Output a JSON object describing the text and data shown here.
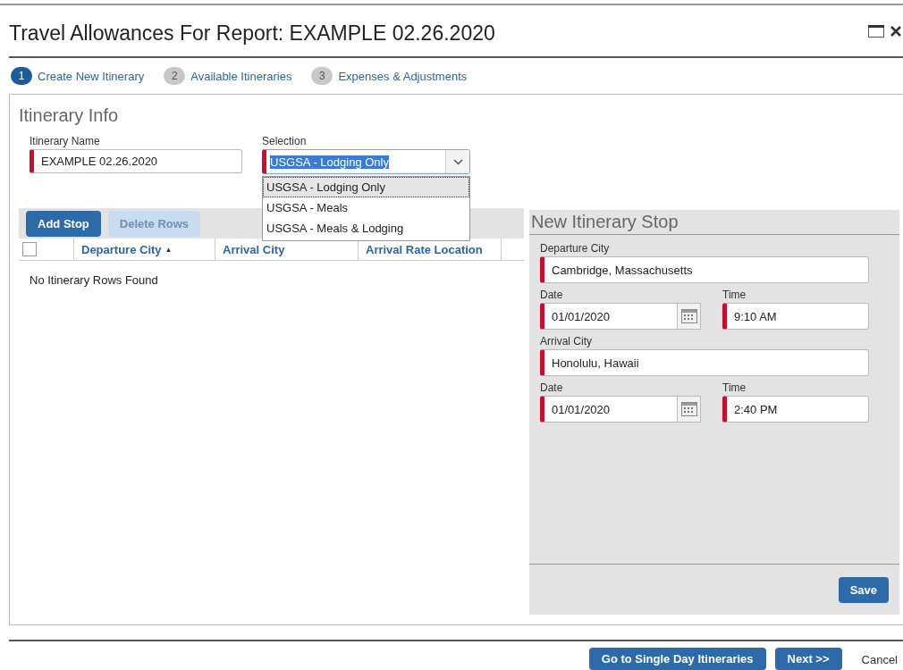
{
  "window": {
    "title": "Travel Allowances For Report: EXAMPLE 02.26.2020"
  },
  "steps": [
    {
      "number": "1",
      "label": "Create New Itinerary",
      "selected": true
    },
    {
      "number": "2",
      "label": "Available Itineraries",
      "selected": false
    },
    {
      "number": "3",
      "label": "Expenses & Adjustments",
      "selected": false
    }
  ],
  "itinerary_info": {
    "heading": "Itinerary Info",
    "name_field": {
      "label": "Itinerary Name",
      "value": "EXAMPLE 02.26.2020",
      "required": true
    },
    "selection_field": {
      "label": "Selection",
      "value": "USGSA - Lodging Only",
      "required": true,
      "expanded": true,
      "options": [
        {
          "label": "USGSA - Lodging Only",
          "selected": true
        },
        {
          "label": "USGSA - Meals",
          "selected": false
        },
        {
          "label": "USGSA - Meals & Lodging",
          "selected": false
        }
      ]
    }
  },
  "toolbar": [
    {
      "label": "Add Stop",
      "disabled": false
    },
    {
      "label": "Delete Rows",
      "disabled": true
    }
  ],
  "table": {
    "select_all_checked": false,
    "columns": [
      {
        "label": "Departure City",
        "sort_mark": "▲"
      },
      {
        "label": "Arrival City"
      },
      {
        "label": "Arrival Rate Location"
      }
    ],
    "empty_message": "No Itinerary Rows Found"
  },
  "stop_panel": {
    "heading": "New Itinerary Stop",
    "fields": [
      {
        "kind": "full",
        "label": "Departure City",
        "value": "Cambridge, Massachusetts",
        "required": true
      },
      {
        "kind": "pair",
        "date_label": "Date",
        "date": "01/01/2020",
        "time_label": "Time",
        "time": "9:10 AM",
        "required": true
      },
      {
        "kind": "full",
        "label": "Arrival City",
        "value": "Honolulu, Hawaii",
        "required": true
      },
      {
        "kind": "pair",
        "date_label": "Date",
        "date": "01/01/2020",
        "time_label": "Time",
        "time": "2:40 PM",
        "required": true
      }
    ],
    "save": "Save"
  },
  "footer": [
    {
      "label": "Go to Single Day Itineraries",
      "kind": "primary"
    },
    {
      "label": "Next >>",
      "kind": "primary"
    },
    {
      "label": "Cancel",
      "kind": "link"
    }
  ]
}
